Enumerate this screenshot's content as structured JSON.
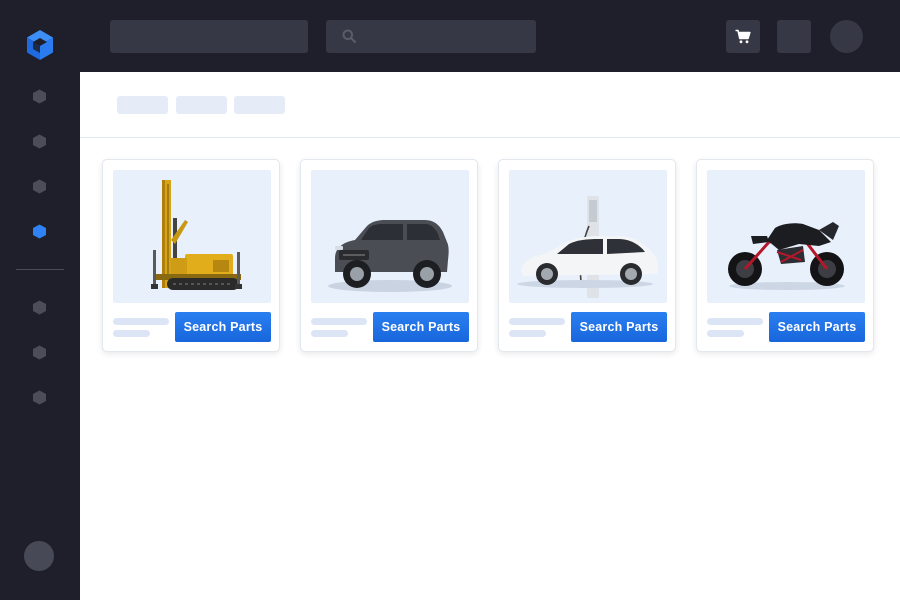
{
  "app": {
    "logo_icon": "isometric-cube-logo-icon",
    "accent_color": "#1f6ee6"
  },
  "sidebar": {
    "items": [
      {
        "icon": "hexagon-icon",
        "active": false
      },
      {
        "icon": "hexagon-icon",
        "active": false
      },
      {
        "icon": "hexagon-icon",
        "active": false
      },
      {
        "icon": "hexagon-icon",
        "active": true
      },
      {
        "icon": "hexagon-icon",
        "active": false
      },
      {
        "icon": "hexagon-icon",
        "active": false
      },
      {
        "icon": "hexagon-icon",
        "active": false
      }
    ],
    "active_color": "#2e82f5",
    "inactive_color": "#4b4d59"
  },
  "header": {
    "search_icon": "search-icon",
    "cart_icon": "cart-icon"
  },
  "products": {
    "button_label": "Search Parts",
    "cards": [
      {
        "image": "drilling-rig-image",
        "button_label": "Search Parts"
      },
      {
        "image": "suv-image",
        "button_label": "Search Parts"
      },
      {
        "image": "electric-car-charging-image",
        "button_label": "Search Parts"
      },
      {
        "image": "motorcycle-image",
        "button_label": "Search Parts"
      }
    ]
  }
}
